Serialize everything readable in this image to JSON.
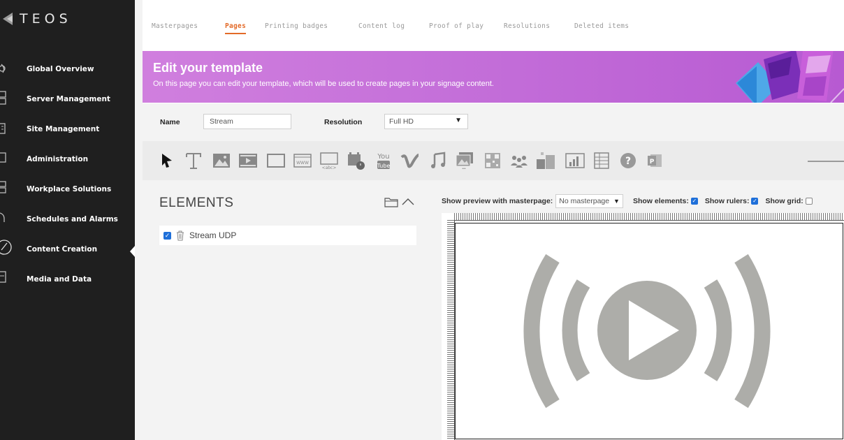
{
  "app": {
    "logo_text": "TEOS"
  },
  "sidebar": {
    "items": [
      {
        "label": "Global Overview"
      },
      {
        "label": "Server Management"
      },
      {
        "label": "Site Management"
      },
      {
        "label": "Administration"
      },
      {
        "label": "Workplace Solutions"
      },
      {
        "label": "Schedules and Alarms"
      },
      {
        "label": "Content Creation",
        "active": true
      },
      {
        "label": "Media and Data"
      }
    ]
  },
  "tabs": [
    {
      "label": "Masterpages"
    },
    {
      "label": "Pages",
      "active": true
    },
    {
      "label": "Printing badges"
    },
    {
      "label": "Content log"
    },
    {
      "label": "Proof of play"
    },
    {
      "label": "Resolutions"
    },
    {
      "label": "Deleted items"
    }
  ],
  "banner": {
    "title": "Edit your template",
    "subtitle": "On this page you can edit your template, which will be used to create pages in your signage content."
  },
  "form": {
    "name_label": "Name",
    "name_value": "Stream",
    "resolution_label": "Resolution",
    "resolution_value": "Full HD"
  },
  "toolbar": {
    "tools": [
      "pointer-icon",
      "text-icon",
      "image-icon",
      "video-icon",
      "rectangle-icon",
      "web-icon",
      "ticker-icon",
      "calendar-icon",
      "youtube-icon",
      "vimeo-icon",
      "audio-icon",
      "slideshow-icon",
      "qrcode-icon",
      "people-icon",
      "tiles-icon",
      "chart-icon",
      "table-icon",
      "help-icon",
      "powerpoint-icon"
    ]
  },
  "elements": {
    "title": "ELEMENTS",
    "items": [
      {
        "label": "Stream UDP",
        "checked": true
      }
    ]
  },
  "preview": {
    "masterpage_label": "Show preview with masterpage:",
    "masterpage_value": "No masterpage",
    "show_elements_label": "Show elements:",
    "show_elements": true,
    "show_rulers_label": "Show rulers:",
    "show_rulers": true,
    "show_grid_label": "Show grid:",
    "show_grid": false
  },
  "colors": {
    "sidebar_bg": "#1f1f1f",
    "accent": "#e36a28",
    "banner": "#c46fd9",
    "checkbox": "#1e6fd9",
    "stream_icon": "#adada9"
  }
}
